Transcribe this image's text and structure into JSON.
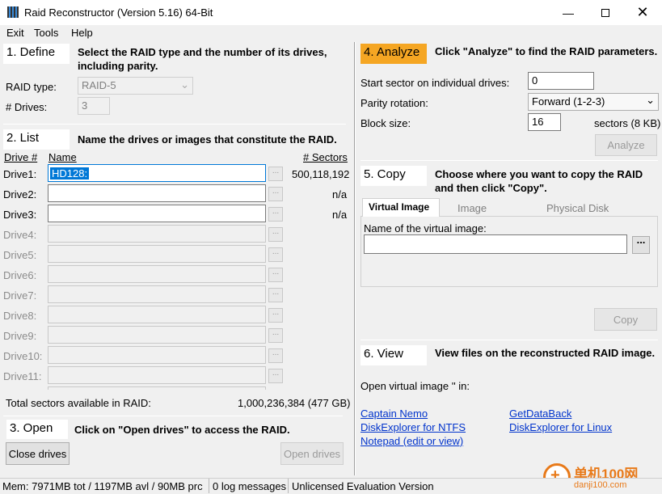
{
  "window": {
    "title": "Raid Reconstructor (Version 5.16) 64-Bit"
  },
  "menu": [
    "Exit",
    "Tools",
    "Help"
  ],
  "define": {
    "head": "1. Define",
    "desc": "Select the RAID type and the number of its drives, including parity.",
    "raid_type_label": "RAID type:",
    "raid_type_value": "RAID-5",
    "drives_label": "# Drives:",
    "drives_value": "3"
  },
  "list": {
    "head": "2. List",
    "desc": "Name the drives or images that constitute the RAID.",
    "col_drive": "Drive #",
    "col_name": "Name",
    "col_sectors": "# Sectors",
    "rows": [
      {
        "drive": "Drive1:",
        "name": "HD128:",
        "sectors": "500,118,192"
      },
      {
        "drive": "Drive2:",
        "name": "",
        "sectors": "n/a"
      },
      {
        "drive": "Drive3:",
        "name": "",
        "sectors": "n/a"
      },
      {
        "drive": "Drive4:",
        "name": "",
        "sectors": ""
      },
      {
        "drive": "Drive5:",
        "name": "",
        "sectors": ""
      },
      {
        "drive": "Drive6:",
        "name": "",
        "sectors": ""
      },
      {
        "drive": "Drive7:",
        "name": "",
        "sectors": ""
      },
      {
        "drive": "Drive8:",
        "name": "",
        "sectors": ""
      },
      {
        "drive": "Drive9:",
        "name": "",
        "sectors": ""
      },
      {
        "drive": "Drive10:",
        "name": "",
        "sectors": ""
      },
      {
        "drive": "Drive11:",
        "name": "",
        "sectors": ""
      }
    ],
    "total_label": "Total sectors available in RAID:",
    "total_value": "1,000,236,384 (477 GB)"
  },
  "open": {
    "head": "3. Open",
    "desc": "Click on \"Open drives\" to access the RAID.",
    "close_btn": "Close drives",
    "open_btn": "Open drives"
  },
  "analyze": {
    "head": "4. Analyze",
    "desc": "Click \"Analyze\" to find the RAID parameters.",
    "start_label": "Start sector on individual drives:",
    "start_value": "0",
    "parity_label": "Parity rotation:",
    "parity_value": "Forward (1-2-3)",
    "block_label": "Block size:",
    "block_value": "16",
    "block_unit": "sectors (8 KB)",
    "analyze_btn": "Analyze"
  },
  "copy": {
    "head": "5. Copy",
    "desc": "Choose where you want to copy the RAID and then click \"Copy\".",
    "tabs": [
      "Virtual Image",
      "Image",
      "Physical Disk"
    ],
    "name_label": "Name of the virtual image:",
    "browse": "...",
    "copy_btn": "Copy"
  },
  "view": {
    "head": "6. View",
    "desc": "View files on the reconstructed RAID image.",
    "open_in": "Open virtual image '' in:",
    "links": [
      "Captain Nemo",
      "GetDataBack",
      "DiskExplorer for NTFS",
      "DiskExplorer for Linux",
      "Notepad (edit or view)"
    ]
  },
  "status": {
    "mem": "Mem: 7971MB tot / 1197MB avl / 90MB prc",
    "log": "0 log messages",
    "license": "Unlicensed Evaluation Version"
  },
  "watermark": {
    "text": "单机100网",
    "url": "danji100.com"
  },
  "colors": {
    "analyze_highlight": "#f5a623",
    "selection": "#0078d7",
    "link": "#0033cc"
  }
}
